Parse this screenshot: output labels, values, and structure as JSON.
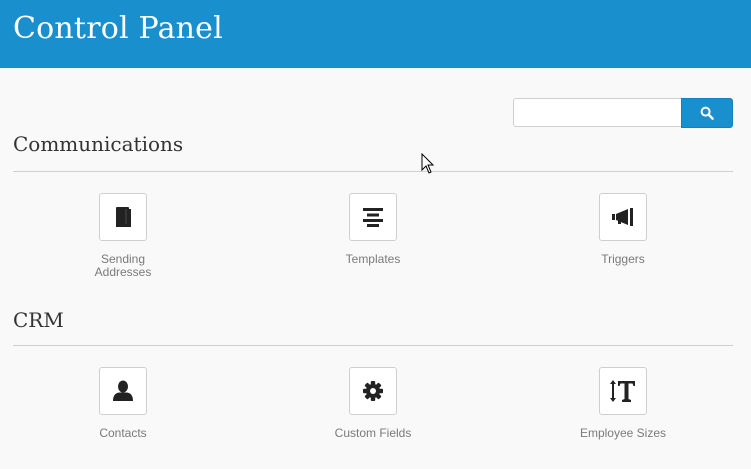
{
  "header": {
    "title": "Control Panel"
  },
  "search": {
    "value": "",
    "placeholder": ""
  },
  "sections": [
    {
      "title": "Communications",
      "items": [
        {
          "label": "Sending Addresses",
          "icon": "book-icon"
        },
        {
          "label": "Templates",
          "icon": "align-center-icon"
        },
        {
          "label": "Triggers",
          "icon": "megaphone-icon"
        }
      ]
    },
    {
      "title": "CRM",
      "items": [
        {
          "label": "Contacts",
          "icon": "user-icon"
        },
        {
          "label": "Custom Fields",
          "icon": "gear-icon"
        },
        {
          "label": "Employee Sizes",
          "icon": "text-height-icon"
        }
      ]
    }
  ],
  "colors": {
    "brand": "#1a8fce",
    "background": "#f9f9f9",
    "icon": "#222222",
    "label": "#7a7a7a"
  }
}
